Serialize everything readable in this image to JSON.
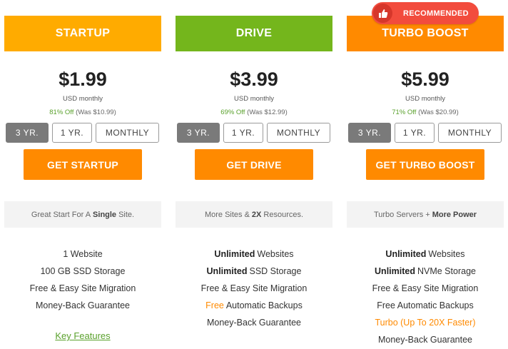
{
  "badge": {
    "label": "RECOMMENDED",
    "icon": "thumbs-up-icon",
    "color": "#f24c3d"
  },
  "colors": {
    "startup": "#ffab00",
    "drive": "#74b61c",
    "turbo": "#ff8a00",
    "cta": "#ff8a00",
    "savings": "#5aa12c"
  },
  "plans": [
    {
      "name": "STARTUP",
      "price": "$1.99",
      "period": "USD monthly",
      "discount": "81% Off",
      "was": "(Was $10.99)",
      "terms": [
        "3 YR.",
        "1 YR.",
        "MONTHLY"
      ],
      "selected_term": "3 YR.",
      "cta": "GET STARTUP",
      "tagline": {
        "text": "Great Start For A",
        "bold": "Single",
        "suffix": "Site."
      },
      "features": [
        {
          "bold": "",
          "text": "1 Website"
        },
        {
          "bold": "",
          "text": "100 GB SSD Storage"
        },
        {
          "bold": "",
          "text": "Free & Easy Site Migration"
        },
        {
          "bold": "",
          "text": "Money-Back Guarantee"
        }
      ],
      "link": "Key Features"
    },
    {
      "name": "DRIVE",
      "price": "$3.99",
      "period": "USD monthly",
      "discount": "69% Off",
      "was": "(Was $12.99)",
      "terms": [
        "3 YR.",
        "1 YR.",
        "MONTHLY"
      ],
      "selected_term": "3 YR.",
      "cta": "GET DRIVE",
      "tagline": {
        "text": "More Sites &",
        "bold": "2X",
        "suffix": "Resources."
      },
      "features": [
        {
          "bold": "Unlimited",
          "text": "Websites"
        },
        {
          "bold": "Unlimited",
          "text": "SSD Storage"
        },
        {
          "bold": "",
          "text": "Free & Easy Site Migration"
        },
        {
          "hl": "Free",
          "text": "Automatic Backups"
        },
        {
          "bold": "",
          "text": "Money-Back Guarantee"
        }
      ]
    },
    {
      "name": "TURBO BOOST",
      "price": "$5.99",
      "period": "USD monthly",
      "discount": "71% Off",
      "was": "(Was $20.99)",
      "terms": [
        "3 YR.",
        "1 YR.",
        "MONTHLY"
      ],
      "selected_term": "3 YR.",
      "cta": "GET TURBO BOOST",
      "tagline": {
        "text": "Turbo Servers",
        "mid": "+",
        "bold": "More Power"
      },
      "features": [
        {
          "bold": "Unlimited",
          "text": "Websites"
        },
        {
          "bold": "Unlimited",
          "text": "NVMe Storage"
        },
        {
          "bold": "",
          "text": "Free & Easy Site Migration"
        },
        {
          "bold": "",
          "text": "Free Automatic Backups"
        },
        {
          "hl": "Turbo (Up To 20X Faster)",
          "text": ""
        },
        {
          "bold": "",
          "text": "Money-Back Guarantee"
        }
      ]
    }
  ]
}
